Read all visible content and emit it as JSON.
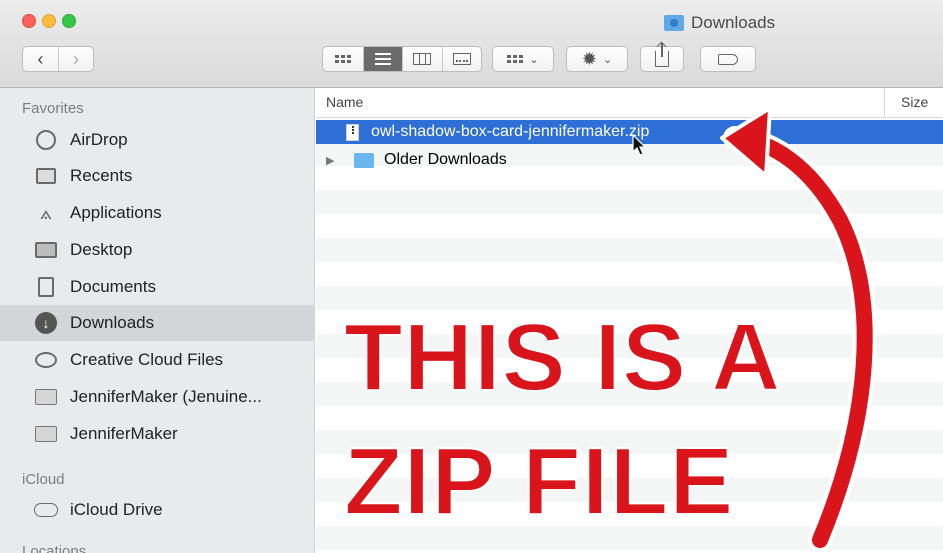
{
  "window": {
    "title": "Downloads"
  },
  "toolbar": {
    "back": "‹",
    "forward": "›",
    "gear": "✹",
    "caret": "⌄"
  },
  "sidebar": {
    "favorites_header": "Favorites",
    "items": [
      {
        "label": "AirDrop",
        "icon": "airdrop-icon"
      },
      {
        "label": "Recents",
        "icon": "recents-icon"
      },
      {
        "label": "Applications",
        "icon": "applications-icon"
      },
      {
        "label": "Desktop",
        "icon": "desktop-icon"
      },
      {
        "label": "Documents",
        "icon": "documents-icon"
      },
      {
        "label": "Downloads",
        "icon": "downloads-icon",
        "selected": true
      },
      {
        "label": "Creative Cloud Files",
        "icon": "creative-cloud-icon"
      },
      {
        "label": "JenniferMaker (Jenuine...",
        "icon": "folder-icon"
      },
      {
        "label": "JenniferMaker",
        "icon": "folder-icon"
      }
    ],
    "icloud_header": "iCloud",
    "icloud_items": [
      {
        "label": "iCloud Drive",
        "icon": "cloud-icon"
      }
    ],
    "locations_header": "Locations"
  },
  "main": {
    "columns": {
      "name": "Name",
      "size": "Size"
    },
    "rows": [
      {
        "name": "owl-shadow-box-card-jennifermaker.zip",
        "type": "zip-file",
        "selected": true
      },
      {
        "name": "Older Downloads",
        "type": "folder",
        "expandable": true
      }
    ]
  },
  "annotation": {
    "line1": "THIS IS A",
    "line2": "ZIP FILE",
    "color": "#d9141a"
  }
}
